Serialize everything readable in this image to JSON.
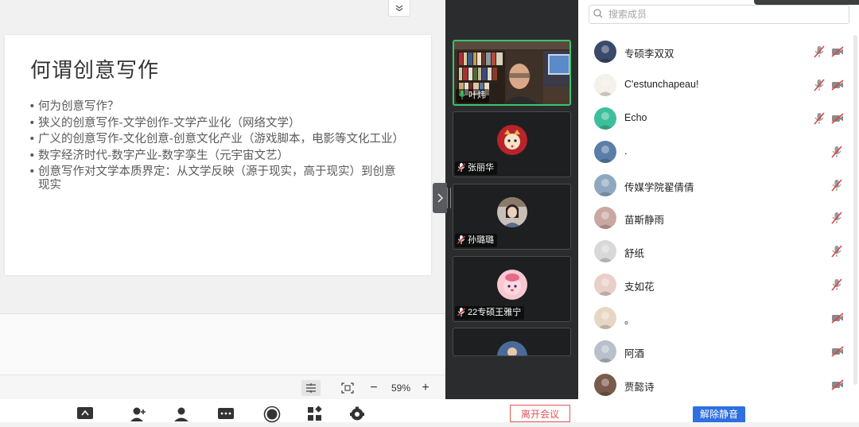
{
  "slide": {
    "title": "何谓创意写作",
    "bullets": [
      "何为创意写作？",
      "狭义的创意写作-文学创作-文学产业化（网络文学）",
      "广义的创意写作-文化创意-创意文化产业（游戏脚本，电影等文化工业）",
      "数字经济时代-数字产业-数字孪生（元宇宙文艺）",
      "创意写作对文学本质界定：从文学反映（源于现实，高于现实）到创意现实"
    ]
  },
  "zoom": {
    "level": "59%",
    "minus": "−",
    "plus": "+"
  },
  "toolbar": {
    "leave_label": "离开会议",
    "unmute_all_label": "解除静音"
  },
  "video_tiles": [
    {
      "name": "叶炜",
      "active": true,
      "muted": false
    },
    {
      "name": "张丽华",
      "active": false,
      "muted": true
    },
    {
      "name": "孙璐璐",
      "active": false,
      "muted": true
    },
    {
      "name": "22专硕王雅宁",
      "active": false,
      "muted": true
    },
    {
      "name": "",
      "active": false,
      "muted": true
    }
  ],
  "search": {
    "placeholder": "搜索成员"
  },
  "members": [
    {
      "name": "专硕李双双",
      "mic": "muted",
      "cam": "off",
      "avatar_color": "#3a4a6a"
    },
    {
      "name": "C'estunchapeau!",
      "mic": "muted",
      "cam": "off",
      "avatar_color": "#f4f0ea"
    },
    {
      "name": "Echo",
      "mic": "muted",
      "cam": "off",
      "avatar_color": "#3cbf9a"
    },
    {
      "name": ".",
      "mic": "muted",
      "cam": "none",
      "avatar_color": "#5b7ea8"
    },
    {
      "name": "传媒学院翟倩倩",
      "mic": "muted",
      "cam": "none",
      "avatar_color": "#8fa8c0"
    },
    {
      "name": "苗斯静雨",
      "mic": "muted",
      "cam": "none",
      "avatar_color": "#c8a8a0"
    },
    {
      "name": "舒纸",
      "mic": "muted",
      "cam": "none",
      "avatar_color": "#d8d8d8"
    },
    {
      "name": "支如花",
      "mic": "muted",
      "cam": "none",
      "avatar_color": "#e8d0c8"
    },
    {
      "name": "。",
      "mic": "none",
      "cam": "off",
      "avatar_color": "#e8d6c4"
    },
    {
      "name": "阿酒",
      "mic": "none",
      "cam": "off",
      "avatar_color": "#b8c0cc"
    },
    {
      "name": "贾懿诗",
      "mic": "none",
      "cam": "off",
      "avatar_color": "#7a5a4a"
    }
  ],
  "colors": {
    "accent": "#2f6fe0",
    "danger": "#e05555",
    "active_speaker": "#3bc46a"
  }
}
